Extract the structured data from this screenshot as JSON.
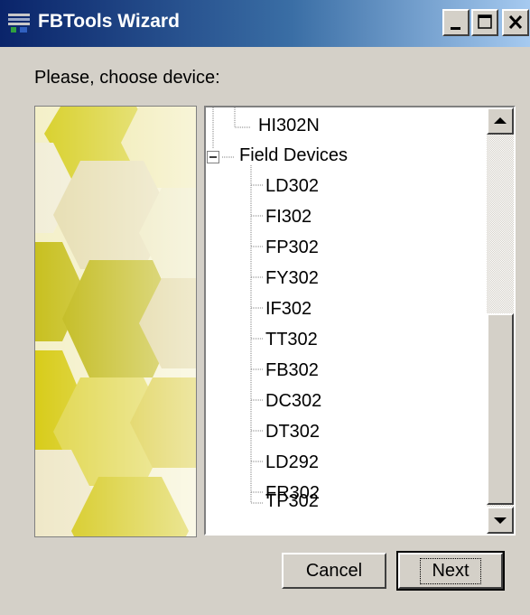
{
  "window": {
    "title": "FBTools Wizard"
  },
  "prompt": "Please, choose device:",
  "tree": {
    "items": [
      {
        "label": "HI302N"
      },
      {
        "label": "Field Devices"
      },
      {
        "label": "LD302"
      },
      {
        "label": "FI302"
      },
      {
        "label": "FP302"
      },
      {
        "label": "FY302"
      },
      {
        "label": "IF302"
      },
      {
        "label": "TT302"
      },
      {
        "label": "FB302"
      },
      {
        "label": "DC302"
      },
      {
        "label": "DT302"
      },
      {
        "label": "LD292"
      },
      {
        "label": "FR302"
      },
      {
        "label": "TP302"
      }
    ]
  },
  "buttons": {
    "cancel": "Cancel",
    "next": "Next"
  },
  "colors": {
    "titlebar_start": "#0a246a",
    "titlebar_end": "#a6caf0",
    "face": "#d4d0c8",
    "decor_yellow": "#d8cc1a"
  }
}
